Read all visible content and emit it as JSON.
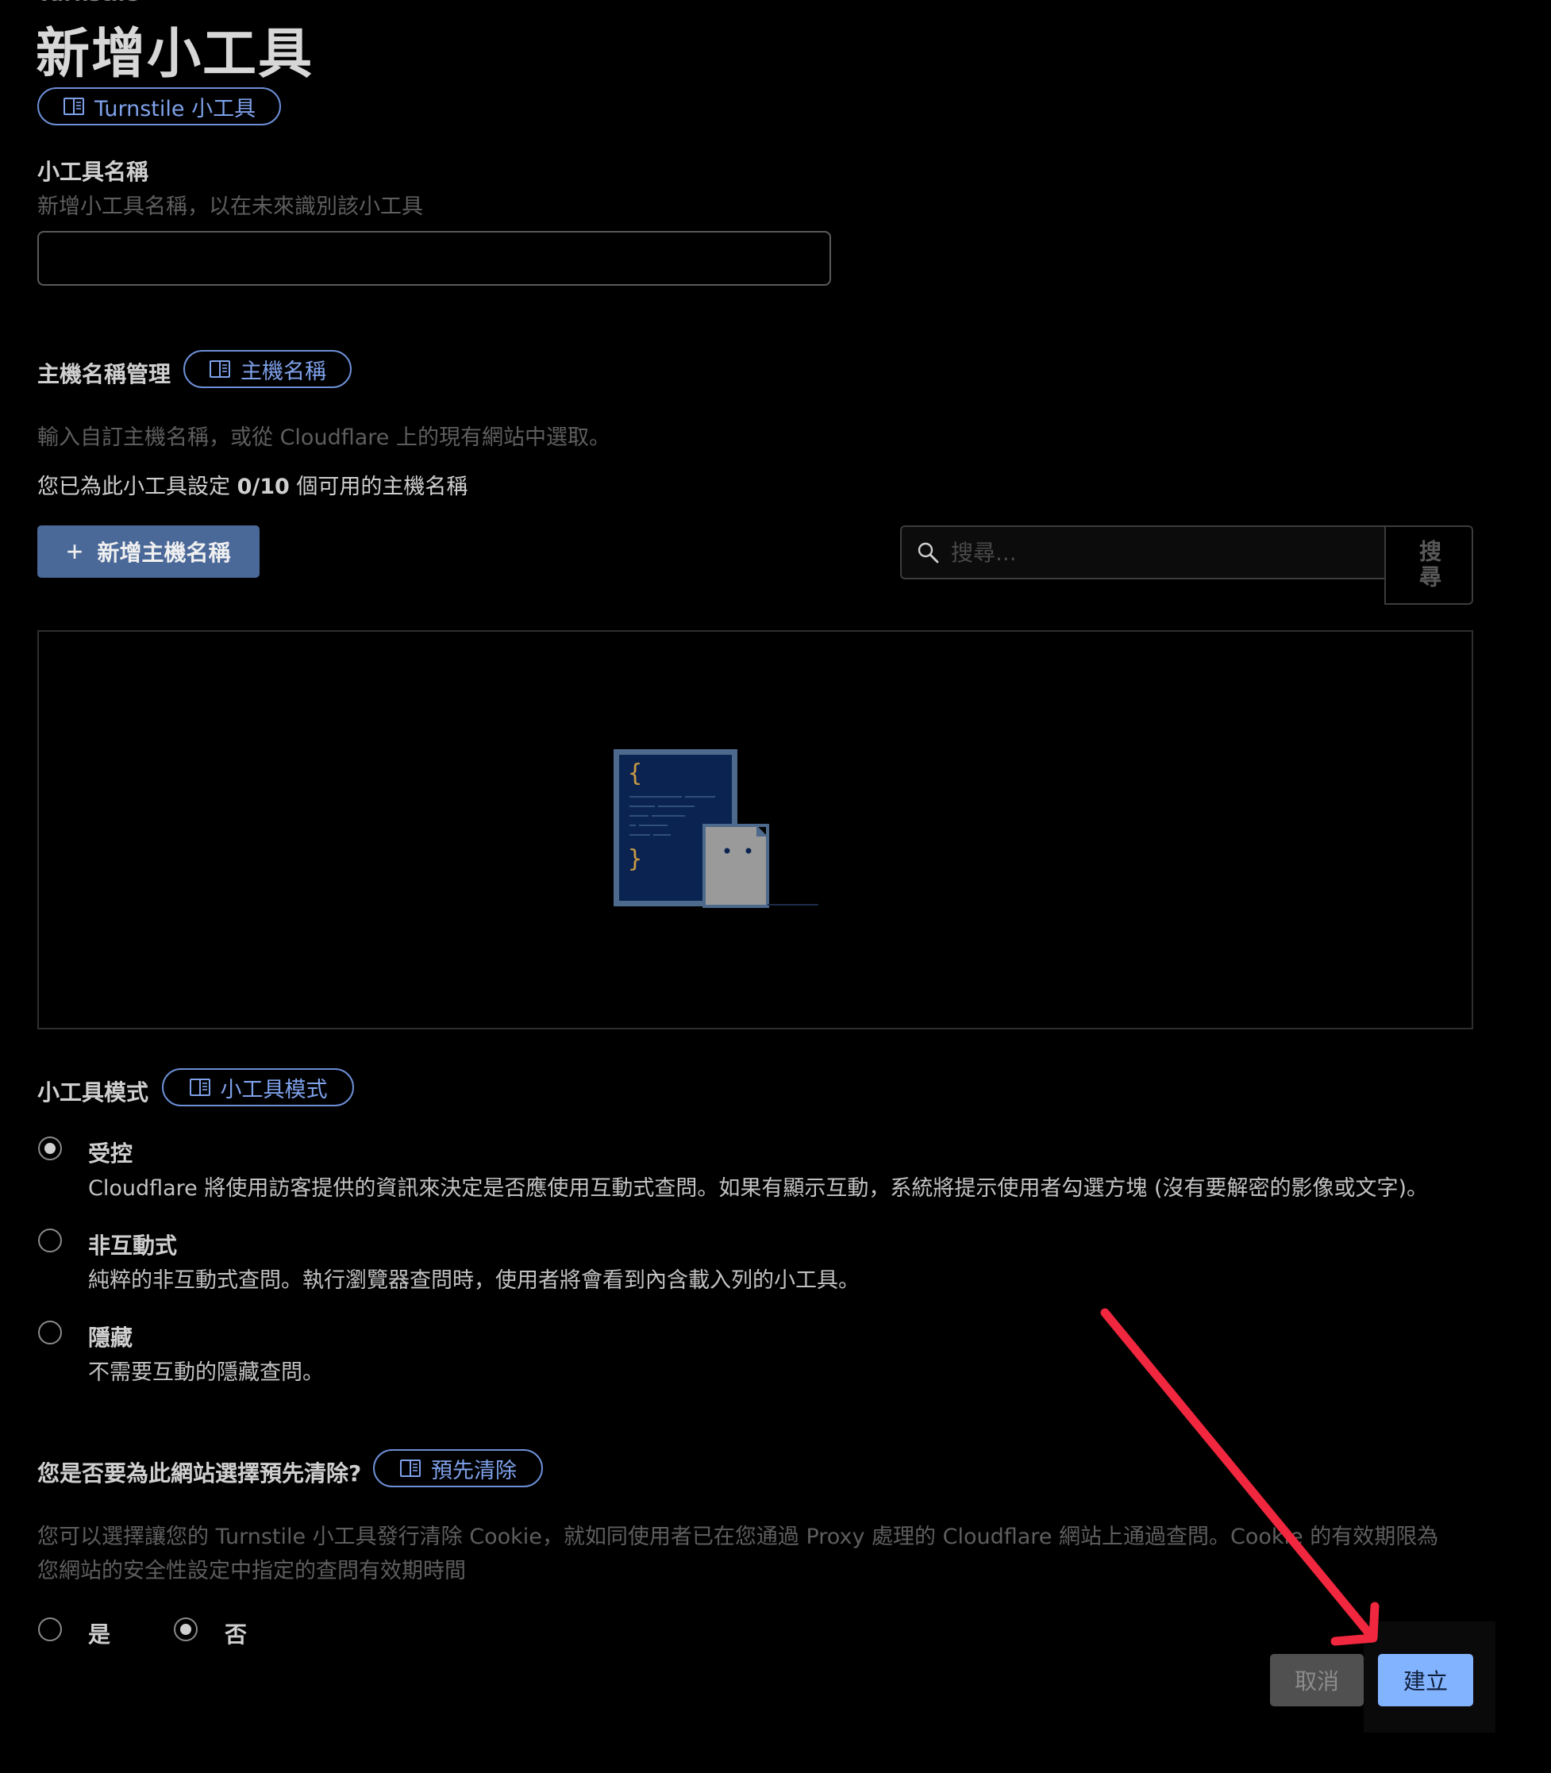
{
  "header": {
    "breadcrumb_partial": "Turnstile",
    "title": "新增小工具",
    "doc_link_label": "Turnstile 小工具"
  },
  "widget_name": {
    "label": "小工具名稱",
    "help": "新增小工具名稱，以在未來識別該小工具",
    "value": "",
    "placeholder": ""
  },
  "hostname": {
    "label": "主機名稱管理",
    "doc_link_label": "主機名稱",
    "help": "輸入自訂主機名稱，或從 Cloudflare 上的現有網站中選取。",
    "count_prefix": "您已為此小工具設定",
    "count_value": "0/10",
    "count_suffix": "個可用的主機名稱",
    "add_button_label": "新增主機名稱",
    "search_placeholder": "搜尋...",
    "search_button_label": "搜尋"
  },
  "mode": {
    "label": "小工具模式",
    "doc_link_label": "小工具模式",
    "options": [
      {
        "title": "受控",
        "description": "Cloudflare 將使用訪客提供的資訊來決定是否應使用互動式查問。如果有顯示互動，系統將提示使用者勾選方塊 (沒有要解密的影像或文字)。",
        "selected": true
      },
      {
        "title": "非互動式",
        "description": "純粹的非互動式查問。執行瀏覽器查問時，使用者將會看到內含載入列的小工具。",
        "selected": false
      },
      {
        "title": "隱藏",
        "description": "不需要互動的隱藏查問。",
        "selected": false
      }
    ]
  },
  "preclearance": {
    "label": "您是否要為此網站選擇預先清除?",
    "doc_link_label": "預先清除",
    "help_line1": "您可以選擇讓您的 Turnstile 小工具發行清除 Cookie，就如同使用者已在您通過 Proxy 處理的 Cloudflare 網站上通過查問。Cookie 的有效期限為",
    "help_line2": "您網站的安全性設定中指定的查問有效期時間",
    "yes_label": "是",
    "no_label": "否",
    "selected": "否"
  },
  "footer": {
    "cancel_label": "取消",
    "create_label": "建立"
  },
  "colors": {
    "background": "#000000",
    "link": "#7ea1ea",
    "primary_button": "#82b3ff",
    "add_button": "#4a6898",
    "annotation_arrow": "#f0273e"
  },
  "icons": {
    "doc_link": "book-open-icon",
    "add": "plus-icon",
    "search": "search-icon",
    "empty_state": "code-document-illustration",
    "annotation": "red-arrow-annotation"
  }
}
